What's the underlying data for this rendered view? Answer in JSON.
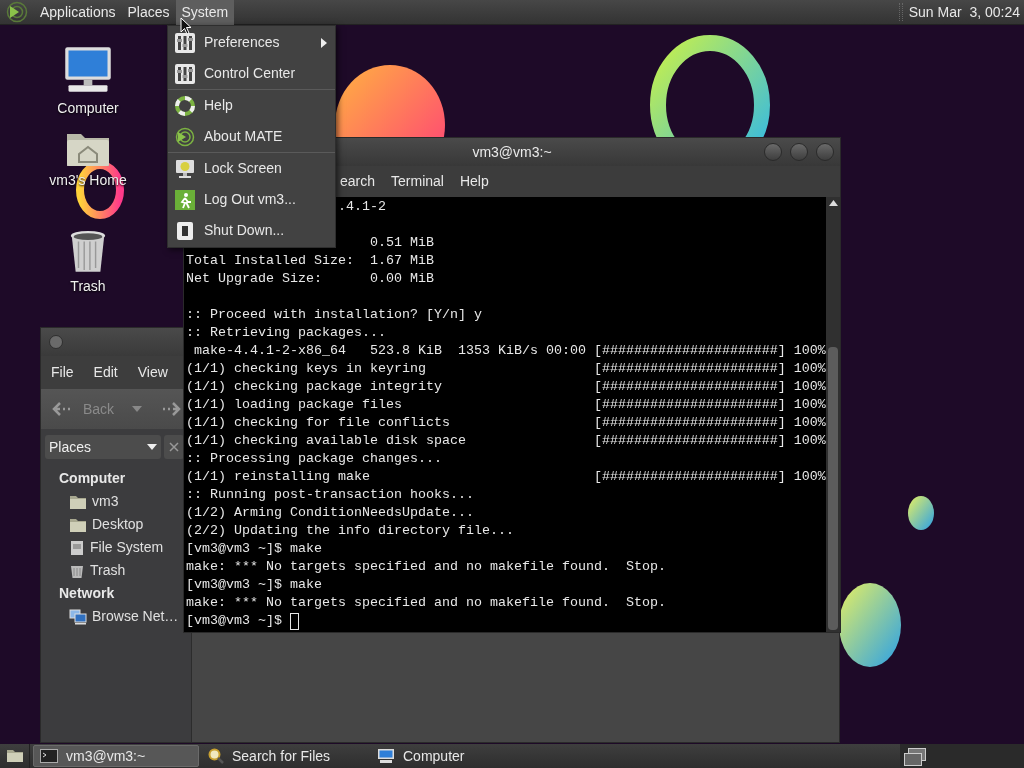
{
  "top_panel": {
    "menus": [
      {
        "label": "Applications",
        "selected": false
      },
      {
        "label": "Places",
        "selected": false
      },
      {
        "label": "System",
        "selected": true
      }
    ],
    "clock": "Sun Mar  3, 00:24"
  },
  "desktop_icons": [
    {
      "label": "Computer"
    },
    {
      "label": "vm3's Home"
    },
    {
      "label": "Trash"
    }
  ],
  "system_menu": {
    "groups": [
      {
        "items": [
          {
            "label": "Preferences",
            "submenu": true
          },
          {
            "label": "Control Center",
            "submenu": false
          }
        ]
      },
      {
        "items": [
          {
            "label": "Help",
            "submenu": false
          },
          {
            "label": "About MATE",
            "submenu": false
          }
        ]
      },
      {
        "items": [
          {
            "label": "Lock Screen",
            "submenu": false
          },
          {
            "label": "Log Out vm3...",
            "submenu": false
          },
          {
            "label": "Shut Down...",
            "submenu": false
          }
        ]
      }
    ]
  },
  "terminal": {
    "title": "vm3@vm3:~",
    "menus": [
      "earch",
      "Terminal",
      "Help"
    ],
    "lines": [
      {
        "kind": "output",
        "text": "                   .4.1-2"
      },
      {
        "kind": "blank"
      },
      {
        "kind": "output",
        "text": "                       0.51 MiB"
      },
      {
        "kind": "output",
        "text": "Total Installed Size:  1.67 MiB"
      },
      {
        "kind": "output",
        "text": "Net Upgrade Size:      0.00 MiB"
      },
      {
        "kind": "blank"
      },
      {
        "kind": "output",
        "text": ":: Proceed with installation? [Y/n] y"
      },
      {
        "kind": "output",
        "text": ":: Retrieving packages..."
      },
      {
        "kind": "output",
        "text": " make-4.4.1-2-x86_64   523.8 KiB  1353 KiB/s 00:00 [######################] 100%"
      },
      {
        "kind": "output",
        "text": "(1/1) checking keys in keyring                     [######################] 100%"
      },
      {
        "kind": "output",
        "text": "(1/1) checking package integrity                   [######################] 100%"
      },
      {
        "kind": "output",
        "text": "(1/1) loading package files                        [######################] 100%"
      },
      {
        "kind": "output",
        "text": "(1/1) checking for file conflicts                  [######################] 100%"
      },
      {
        "kind": "output",
        "text": "(1/1) checking available disk space                [######################] 100%"
      },
      {
        "kind": "output",
        "text": ":: Processing package changes..."
      },
      {
        "kind": "output",
        "text": "(1/1) reinstalling make                            [######################] 100%"
      },
      {
        "kind": "output",
        "text": ":: Running post-transaction hooks..."
      },
      {
        "kind": "output",
        "text": "(1/2) Arming ConditionNeedsUpdate..."
      },
      {
        "kind": "output",
        "text": "(2/2) Updating the info directory file..."
      },
      {
        "kind": "output",
        "text": "[vm3@vm3 ~]$ make"
      },
      {
        "kind": "output",
        "text": "make: *** No targets specified and no makefile found.  Stop."
      },
      {
        "kind": "output",
        "text": "[vm3@vm3 ~]$ make"
      },
      {
        "kind": "output",
        "text": "make: *** No targets specified and no makefile found.  Stop."
      },
      {
        "kind": "prompt",
        "text": "[vm3@vm3 ~]$",
        "cursor": true
      }
    ]
  },
  "file_manager": {
    "menus": [
      "File",
      "Edit",
      "View"
    ],
    "back_button": {
      "label": "Back",
      "disabled": true
    },
    "sidebar": {
      "selector": "Places",
      "sections": [
        {
          "heading": "Computer",
          "items": [
            "vm3",
            "Desktop",
            "File System",
            "Trash"
          ]
        },
        {
          "heading": "Network",
          "items": [
            "Browse Net…"
          ]
        }
      ]
    }
  },
  "taskbar": {
    "windows": [
      {
        "label": "vm3@vm3:~",
        "selected": true
      },
      {
        "label": "Search for Files",
        "selected": false
      },
      {
        "label": "Computer",
        "selected": false
      }
    ]
  }
}
